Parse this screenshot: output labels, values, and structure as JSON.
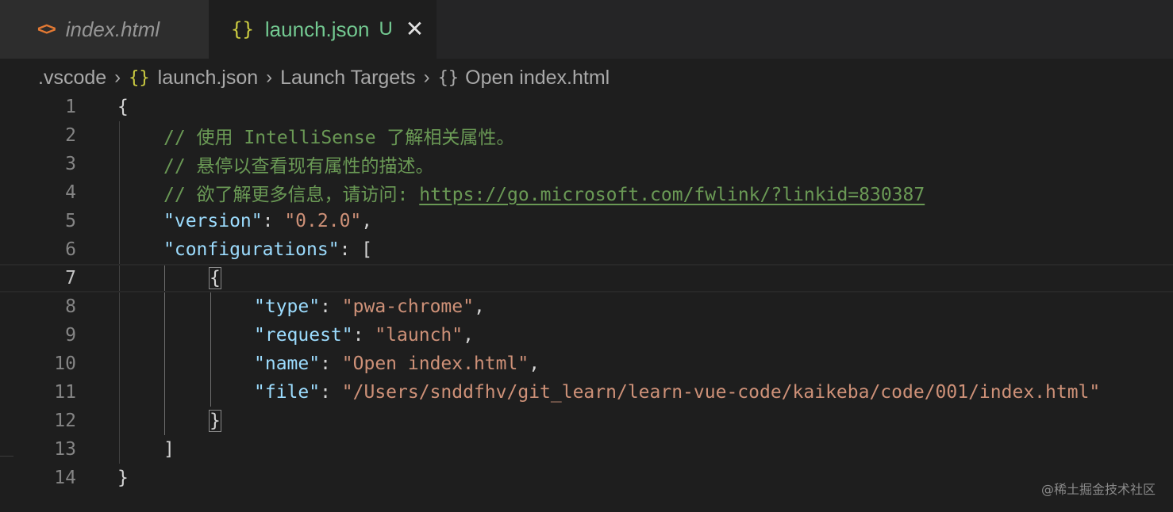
{
  "tabs": [
    {
      "label": "index.html",
      "icon": "html-code-icon",
      "active": false
    },
    {
      "label": "launch.json",
      "icon": "json-braces-icon",
      "active": true,
      "badge": "U",
      "close": "✕"
    }
  ],
  "breadcrumb": {
    "folder": ".vscode",
    "file": "launch.json",
    "section": "Launch Targets",
    "item": "Open index.html"
  },
  "editor": {
    "lines": [
      {
        "n": "1"
      },
      {
        "n": "2"
      },
      {
        "n": "3"
      },
      {
        "n": "4"
      },
      {
        "n": "5"
      },
      {
        "n": "6"
      },
      {
        "n": "7"
      },
      {
        "n": "8"
      },
      {
        "n": "9"
      },
      {
        "n": "10"
      },
      {
        "n": "11"
      },
      {
        "n": "12"
      },
      {
        "n": "13"
      },
      {
        "n": "14"
      }
    ],
    "current_line": "7",
    "comments": {
      "line2": "// 使用 IntelliSense 了解相关属性。",
      "line3": "// 悬停以查看现有属性的描述。",
      "line4_prefix": "// 欲了解更多信息，请访问: ",
      "line4_link": "https://go.microsoft.com/fwlink/?linkid=830387"
    },
    "version_key": "\"version\"",
    "version_value": "\"0.2.0\"",
    "configurations_key": "\"configurations\"",
    "config": {
      "type_key": "\"type\"",
      "type_value": "\"pwa-chrome\"",
      "request_key": "\"request\"",
      "request_value": "\"launch\"",
      "name_key": "\"name\"",
      "name_value": "\"Open index.html\"",
      "file_key": "\"file\"",
      "file_value": "\"/Users/snddfhv/git_learn/learn-vue-code/kaikeba/code/001/index.html\""
    }
  },
  "watermark": "@稀土掘金技术社区",
  "colors": {
    "background": "#1e1e1e",
    "key": "#9cdcfe",
    "string": "#ce9178",
    "comment": "#6a9955",
    "untracked": "#73c991",
    "json_icon": "#cbcb41",
    "html_icon": "#e37933"
  }
}
